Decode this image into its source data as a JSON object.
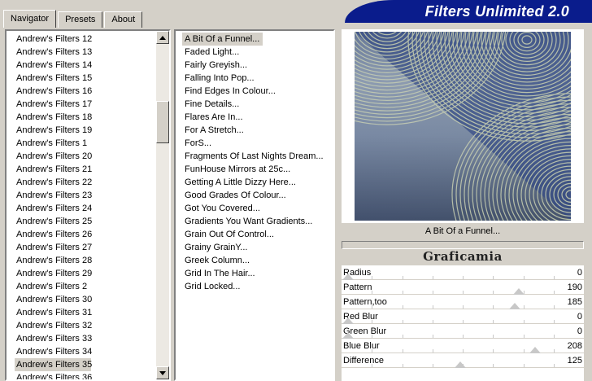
{
  "title": "Filters Unlimited 2.0",
  "tabs": [
    {
      "label": "Navigator",
      "active": true
    },
    {
      "label": "Presets",
      "active": false
    },
    {
      "label": "About",
      "active": false
    }
  ],
  "categories": [
    "Andrew's Filters 12",
    "Andrew's Filters 13",
    "Andrew's Filters 14",
    "Andrew's Filters 15",
    "Andrew's Filters 16",
    "Andrew's Filters 17",
    "Andrew's Filters 18",
    "Andrew's Filters 19",
    "Andrew's Filters 1",
    "Andrew's Filters 20",
    "Andrew's Filters 21",
    "Andrew's Filters 22",
    "Andrew's Filters 23",
    "Andrew's Filters 24",
    "Andrew's Filters 25",
    "Andrew's Filters 26",
    "Andrew's Filters 27",
    "Andrew's Filters 28",
    "Andrew's Filters 29",
    "Andrew's Filters 2",
    "Andrew's Filters 30",
    "Andrew's Filters 31",
    "Andrew's Filters 32",
    "Andrew's Filters 33",
    "Andrew's Filters 34",
    "Andrew's Filters 35",
    "Andrew's Filters 36"
  ],
  "selected_category": "Andrew's Filters 35",
  "filters": [
    "A Bit Of a Funnel...",
    "Faded Light...",
    "Fairly Greyish...",
    "Falling Into Pop...",
    "Find Edges In Colour...",
    "Fine Details...",
    "Flares Are In...",
    "For A Stretch...",
    "ForS...",
    "Fragments Of Last Nights Dream...",
    "FunHouse Mirrors at 25c...",
    "Getting A Little Dizzy Here...",
    "Good Grades Of Colour...",
    "Got You Covered...",
    "Gradients You Want Gradients...",
    "Grain Out Of Control...",
    "Grainy GrainY...",
    "Greek Column...",
    "Grid In The Hair...",
    "Grid Locked..."
  ],
  "selected_filter": "A Bit Of a Funnel...",
  "preview_name": "A Bit Of a Funnel...",
  "author_logo": "Graficamia",
  "parameters": [
    {
      "label": "Radius",
      "value": 0
    },
    {
      "label": "Pattern",
      "value": 190
    },
    {
      "label": "Pattern,too",
      "value": 185
    },
    {
      "label": "Red Blur",
      "value": 0
    },
    {
      "label": "Green Blur",
      "value": 0
    },
    {
      "label": "Blue Blur",
      "value": 208
    },
    {
      "label": "Difference",
      "value": 125
    }
  ],
  "colors": {
    "banner": "#0a1c8c",
    "background": "#d4d0c8",
    "selection": "#d4d0c8"
  }
}
